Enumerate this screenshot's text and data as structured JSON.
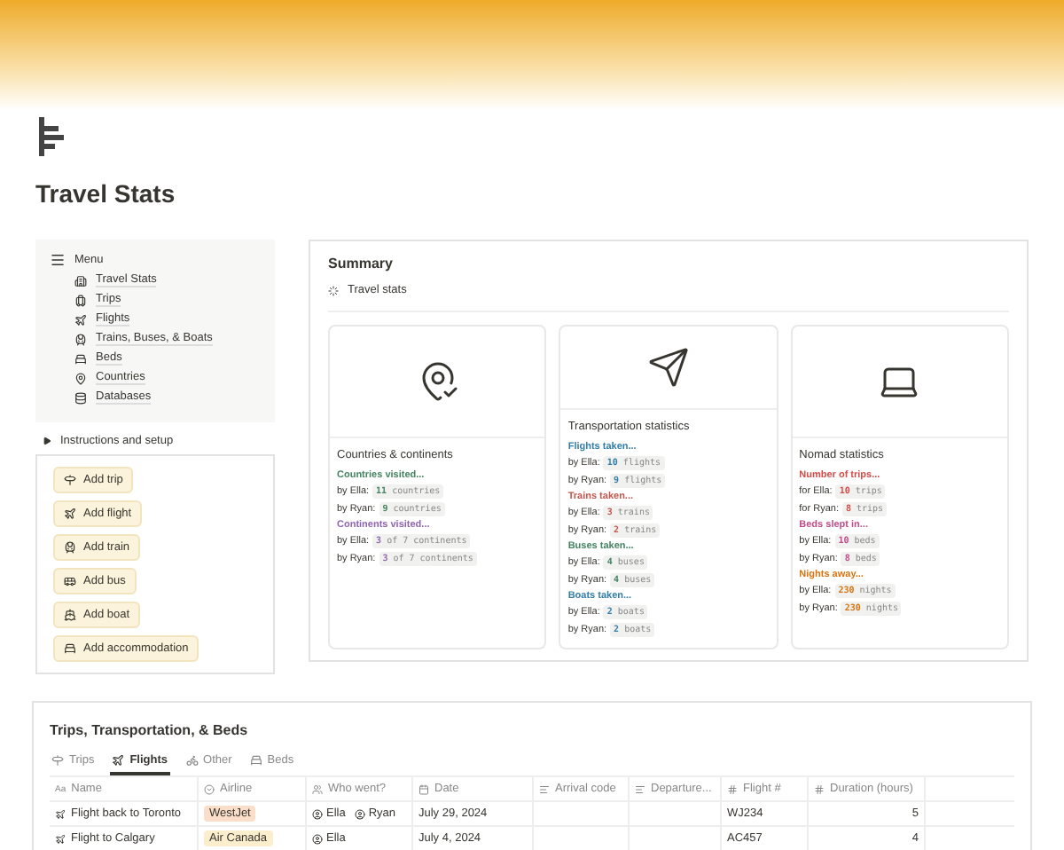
{
  "page": {
    "title": "Travel Stats"
  },
  "menu": {
    "title": "Menu",
    "items": [
      "Travel Stats",
      "Trips",
      "Flights",
      "Trains, Buses, & Boats",
      "Beds",
      "Countries",
      "Databases"
    ]
  },
  "toggle": {
    "label": "Instructions and setup",
    "expanded": false
  },
  "actions": [
    "Add trip",
    "Add flight",
    "Add train",
    "Add bus",
    "Add boat",
    "Add accommodation"
  ],
  "summary": {
    "title": "Summary",
    "view": "Travel stats",
    "cards": [
      {
        "title": "Countries & continents",
        "sections": [
          {
            "heading": "Countries visited...",
            "color": "#448361",
            "lines": [
              {
                "label": "by Ella:",
                "count": "11",
                "unit": "countries"
              },
              {
                "label": "by Ryan:",
                "count": "9",
                "unit": "countries"
              }
            ]
          },
          {
            "heading": "Continents visited...",
            "color": "#9065b0",
            "lines": [
              {
                "label": "by Ella:",
                "count": "3",
                "unit": "of 7 continents"
              },
              {
                "label": "by Ryan:",
                "count": "3",
                "unit": "of 7 continents"
              }
            ]
          }
        ]
      },
      {
        "title": "Transportation statistics",
        "sections": [
          {
            "heading": "Flights taken...",
            "color": "#337ea9",
            "lines": [
              {
                "label": "by Ella:",
                "count": "10",
                "unit": "flights"
              },
              {
                "label": "by Ryan:",
                "count": "9",
                "unit": "flights"
              }
            ]
          },
          {
            "heading": "Trains taken...",
            "color": "#c4554d",
            "lines": [
              {
                "label": "by Ella:",
                "count": "3",
                "unit": "trains"
              },
              {
                "label": "by Ryan:",
                "count": "2",
                "unit": "trains"
              }
            ]
          },
          {
            "heading": "Buses taken...",
            "color": "#448361",
            "lines": [
              {
                "label": "by Ella:",
                "count": "4",
                "unit": "buses"
              },
              {
                "label": "by Ryan:",
                "count": "4",
                "unit": "buses"
              }
            ]
          },
          {
            "heading": "Boats taken...",
            "color": "#337ea9",
            "lines": [
              {
                "label": "by Ella:",
                "count": "2",
                "unit": "boats"
              },
              {
                "label": "by Ryan:",
                "count": "2",
                "unit": "boats"
              }
            ]
          }
        ]
      },
      {
        "title": "Nomad statistics",
        "sections": [
          {
            "heading": "Number of trips...",
            "color": "#d44c47",
            "lines": [
              {
                "label": "for Ella:",
                "count": "10",
                "unit": "trips"
              },
              {
                "label": "for Ryan:",
                "count": "8",
                "unit": "trips"
              }
            ]
          },
          {
            "heading": "Beds slept in...",
            "color": "#c14c8a",
            "lines": [
              {
                "label": "by Ella:",
                "count": "10",
                "unit": "beds"
              },
              {
                "label": "by Ryan:",
                "count": "8",
                "unit": "beds"
              }
            ]
          },
          {
            "heading": "Nights away...",
            "color": "#d9730d",
            "lines": [
              {
                "label": "by Ella:",
                "count": "230",
                "unit": "nights"
              },
              {
                "label": "by Ryan:",
                "count": "230",
                "unit": "nights"
              }
            ]
          }
        ]
      }
    ]
  },
  "database": {
    "title": "Trips, Transportation, & Beds",
    "tabs": [
      {
        "label": "Trips",
        "selected": false
      },
      {
        "label": "Flights",
        "selected": true
      },
      {
        "label": "Other",
        "selected": false
      },
      {
        "label": "Beds",
        "selected": false
      }
    ],
    "name_column_mark": "Aa",
    "columns": [
      "Name",
      "Airline",
      "Who went?",
      "Date",
      "Arrival code",
      "Departure...",
      "Flight #",
      "Duration (hours)"
    ],
    "rows": [
      {
        "name": "Flight back to Toronto",
        "airline": {
          "label": "WestJet",
          "color": "#fadec9"
        },
        "people": [
          "Ella",
          "Ryan"
        ],
        "date": "July 29, 2024",
        "flight": "WJ234",
        "duration": "5"
      },
      {
        "name": "Flight to Calgary",
        "airline": {
          "label": "Air Canada",
          "color": "#fbeecc"
        },
        "people": [
          "Ella"
        ],
        "date": "July 4, 2024",
        "flight": "AC457",
        "duration": "4"
      }
    ]
  }
}
